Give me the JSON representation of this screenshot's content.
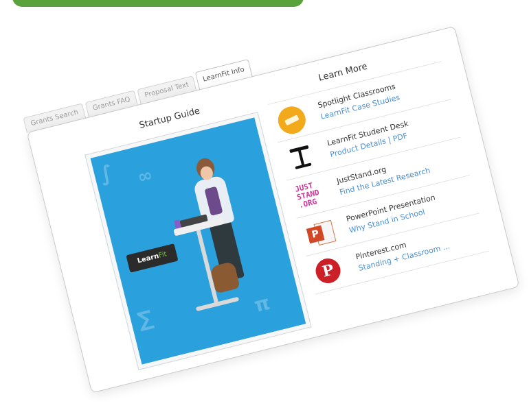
{
  "tabs": [
    "Grants Search",
    "Grants FAQ",
    "Proposal Text",
    "LearnFit Info"
  ],
  "active_tab": "LearnFit Info",
  "startup": {
    "title": "Startup Guide",
    "cover_brand_a": "Learn",
    "cover_brand_b": "Fit"
  },
  "learn_more": {
    "title": "Learn More",
    "items": [
      {
        "name": "Spotlight Classrooms",
        "link": "LearnFit Case Studies",
        "icon": "spotlight-icon"
      },
      {
        "name": "LearnFit Student Desk",
        "link": "Product Details | PDF",
        "icon": "desk-icon"
      },
      {
        "name": "JustStand.org",
        "link": "Find the Latest Research",
        "icon": "juststand-icon"
      },
      {
        "name": "PowerPoint Presentation",
        "link": "Why Stand in School",
        "icon": "powerpoint-icon"
      },
      {
        "name": "Pinterest.com",
        "link": "Standing + Classroom ...",
        "icon": "pinterest-icon"
      }
    ]
  },
  "icon_text": {
    "juststand": "JUST STAND .ORG",
    "powerpoint": "P",
    "pinterest": "P"
  },
  "colors": {
    "accent_green": "#5aa23c",
    "link_blue": "#4a8fd1",
    "cover_blue": "#2aa0dc"
  }
}
